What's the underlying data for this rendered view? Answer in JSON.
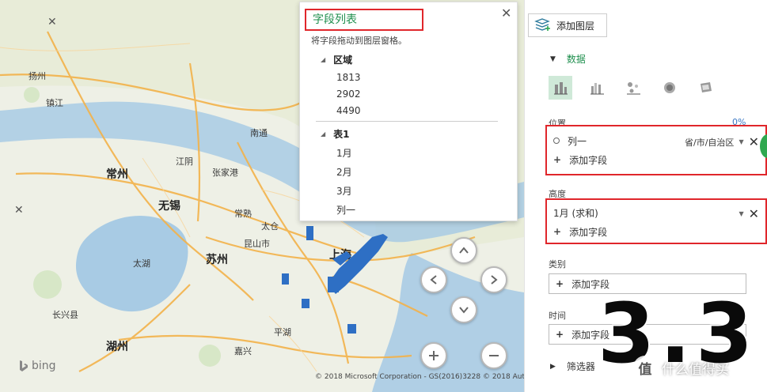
{
  "map": {
    "cities": [
      {
        "key": "yangzhou",
        "label": "扬州"
      },
      {
        "key": "zhenjiang",
        "label": "镇江"
      },
      {
        "key": "changzhou",
        "label": "常州"
      },
      {
        "key": "wuxi",
        "label": "无锡"
      },
      {
        "key": "suzhou",
        "label": "苏州"
      },
      {
        "key": "shanghai",
        "label": "上海"
      },
      {
        "key": "huzhou",
        "label": "湖州"
      },
      {
        "key": "jiaxing",
        "label": "嘉兴"
      },
      {
        "key": "nantong",
        "label": "南通"
      },
      {
        "key": "taicang",
        "label": "太仓"
      },
      {
        "key": "kunshan",
        "label": "昆山市"
      },
      {
        "key": "jiangyin",
        "label": "江阴"
      },
      {
        "key": "zhangjiagang",
        "label": "张家港"
      },
      {
        "key": "changshu",
        "label": "常熟"
      },
      {
        "key": "taihu",
        "label": "太湖"
      },
      {
        "key": "changxing",
        "label": "长兴县"
      },
      {
        "key": "pinghu",
        "label": "平湖"
      }
    ],
    "brand": "bing",
    "copyright": "© 2018 Microsoft Corporation - GS(2016)3228  © 2018 AutoNavi"
  },
  "field_list": {
    "title": "字段列表",
    "subtitle": "将字段拖动到图层窗格。",
    "groups": [
      {
        "name": "区域",
        "items": [
          "1813",
          "2902",
          "4490"
        ]
      },
      {
        "name": "表1",
        "items": [
          "1月",
          "2月",
          "3月",
          "列一"
        ]
      }
    ]
  },
  "pane": {
    "add_layer": "添加图层",
    "data_section": "数据",
    "position_label": "位置",
    "position_pct": "0%",
    "position_field": "列一",
    "position_field_type": "省/市/自治区",
    "add_field": "添加字段",
    "height_label": "高度",
    "height_field": "1月 (求和)",
    "category_label": "类别",
    "time_label": "时间",
    "filter_label": "筛选器"
  },
  "overlay": {
    "big_number": "3.3",
    "watermark": "什么值得买",
    "watermark_icon": "值"
  },
  "colors": {
    "accent_green": "#1f8f4e",
    "highlight_red": "#e0262b",
    "bar_blue": "#2e6fc4"
  }
}
